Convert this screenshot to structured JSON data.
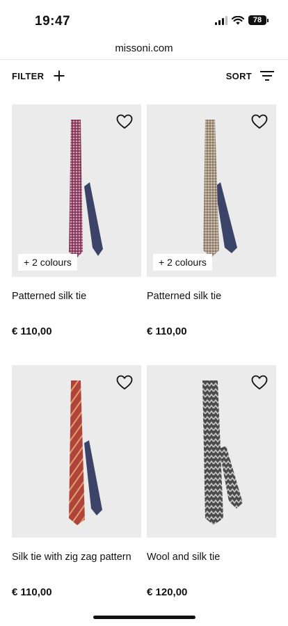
{
  "status_bar": {
    "time": "19:47",
    "battery": "78",
    "icons": [
      "signal-icon",
      "wifi-icon",
      "battery-icon"
    ]
  },
  "browser": {
    "url": "missoni.com"
  },
  "toolbar": {
    "filter_label": "FILTER",
    "sort_label": "SORT",
    "icons": [
      "plus-icon",
      "sort-icon"
    ]
  },
  "products": [
    {
      "name": "Patterned silk tie",
      "price": "€ 110,00",
      "colours_badge": "+ 2 colours",
      "icon": "heart-icon"
    },
    {
      "name": "Patterned silk tie",
      "price": "€ 110,00",
      "colours_badge": "+ 2 colours",
      "icon": "heart-icon"
    },
    {
      "name": "Silk tie with zig zag pattern",
      "price": "€ 110,00",
      "icon": "heart-icon"
    },
    {
      "name": "Wool and silk tie",
      "price": "€ 120,00",
      "icon": "heart-icon"
    }
  ],
  "colors": {
    "card_background": "#ebebeb",
    "tie_1": "#9a4b6e",
    "tie_2": "#a89785",
    "tie_3": "#b0433a",
    "tie_4": "#4a4a4a",
    "tie_back": "#3b4468"
  }
}
